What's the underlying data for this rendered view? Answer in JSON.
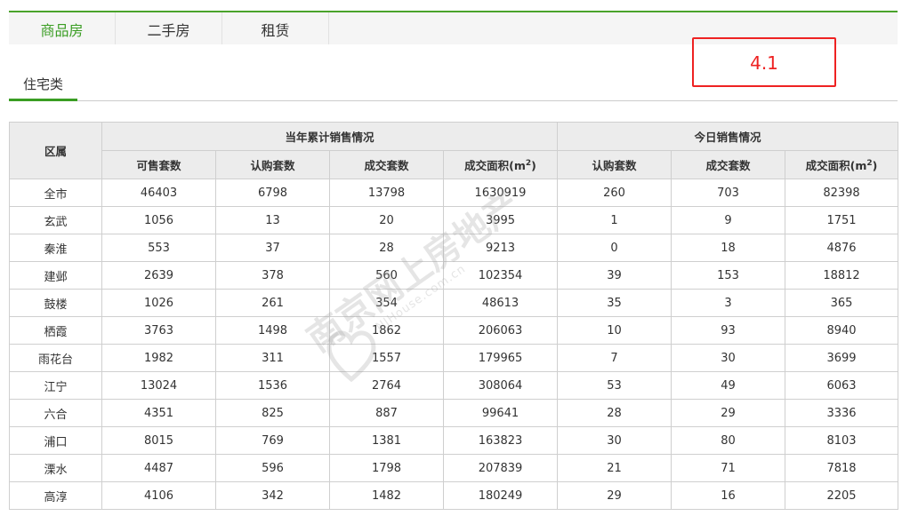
{
  "tabs": [
    "商品房",
    "二手房",
    "租赁"
  ],
  "subtab": "住宅类",
  "annotation": "4.1",
  "table": {
    "district_header": "区属",
    "group_headers": [
      "当年累计销售情况",
      "今日销售情况"
    ],
    "annual_columns": [
      "可售套数",
      "认购套数",
      "成交套数",
      "成交面积(m2)"
    ],
    "today_columns": [
      "认购套数",
      "成交套数",
      "成交面积(m2)"
    ],
    "rows": [
      [
        "全市",
        "46403",
        "6798",
        "13798",
        "1630919",
        "260",
        "703",
        "82398"
      ],
      [
        "玄武",
        "1056",
        "13",
        "20",
        "3995",
        "1",
        "9",
        "1751"
      ],
      [
        "秦淮",
        "553",
        "37",
        "28",
        "9213",
        "0",
        "18",
        "4876"
      ],
      [
        "建邺",
        "2639",
        "378",
        "560",
        "102354",
        "39",
        "153",
        "18812"
      ],
      [
        "鼓楼",
        "1026",
        "261",
        "354",
        "48613",
        "35",
        "3",
        "365"
      ],
      [
        "栖霞",
        "3763",
        "1498",
        "1862",
        "206063",
        "10",
        "93",
        "8940"
      ],
      [
        "雨花台",
        "1982",
        "311",
        "1557",
        "179965",
        "7",
        "30",
        "3699"
      ],
      [
        "江宁",
        "13024",
        "1536",
        "2764",
        "308064",
        "53",
        "49",
        "6063"
      ],
      [
        "六合",
        "4351",
        "825",
        "887",
        "99641",
        "28",
        "29",
        "3336"
      ],
      [
        "浦口",
        "8015",
        "769",
        "1381",
        "163823",
        "30",
        "80",
        "8103"
      ],
      [
        "溧水",
        "4487",
        "596",
        "1798",
        "207839",
        "21",
        "71",
        "7818"
      ],
      [
        "高淳",
        "4106",
        "342",
        "1482",
        "180249",
        "29",
        "16",
        "2205"
      ]
    ]
  },
  "watermark": {
    "main": "南京网上房地产",
    "sub": "NJHouse.com.cn"
  }
}
